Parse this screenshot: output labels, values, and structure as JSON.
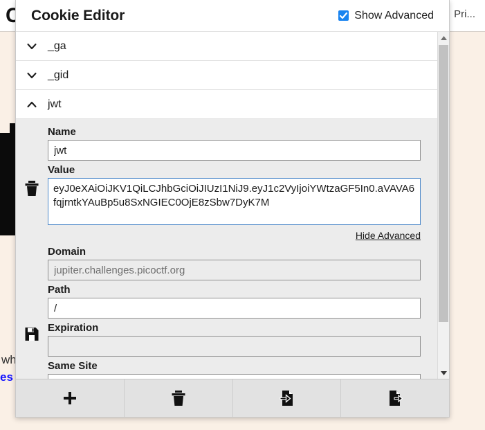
{
  "background": {
    "logo_glyph": "C",
    "nav_right_label": "Pri...",
    "text_fragment": "wh",
    "link_fragment": "es",
    "page_bg_color": "#faf0e6"
  },
  "popup": {
    "title": "Cookie Editor",
    "advanced_toggle": {
      "label": "Show Advanced",
      "checked": true,
      "accent_color": "#1a84f0"
    },
    "cookies": [
      {
        "name": "_ga",
        "expanded": false,
        "chevron": "chevron-down-icon"
      },
      {
        "name": "_gid",
        "expanded": false,
        "chevron": "chevron-down-icon"
      },
      {
        "name": "jwt",
        "expanded": true,
        "chevron": "chevron-up-icon"
      }
    ],
    "detail": {
      "gutter": {
        "delete_icon": "trash-icon",
        "save_icon": "floppy-save-icon"
      },
      "fields": {
        "name_label": "Name",
        "name_value": "jwt",
        "value_label": "Value",
        "value_value": "eyJ0eXAiOiJKV1QiLCJhbGciOiJIUzI1NiJ9.eyJ1c2VyIjoiYWtzaGF5In0.aVAVA6fqjrntkYAuBp5u8SxNGIEC0OjE8zSbw7DyK7M",
        "hide_advanced_label": "Hide Advanced",
        "domain_label": "Domain",
        "domain_value": "jupiter.challenges.picoctf.org",
        "path_label": "Path",
        "path_value": "/",
        "expiration_label": "Expiration",
        "expiration_value": "",
        "same_site_label": "Same Site",
        "same_site_value": ""
      }
    },
    "footer_buttons": [
      {
        "name": "add-cookie-button",
        "icon": "plus-icon"
      },
      {
        "name": "delete-all-button",
        "icon": "trash-icon"
      },
      {
        "name": "import-button",
        "icon": "file-import-icon"
      },
      {
        "name": "export-button",
        "icon": "file-export-icon"
      }
    ]
  }
}
